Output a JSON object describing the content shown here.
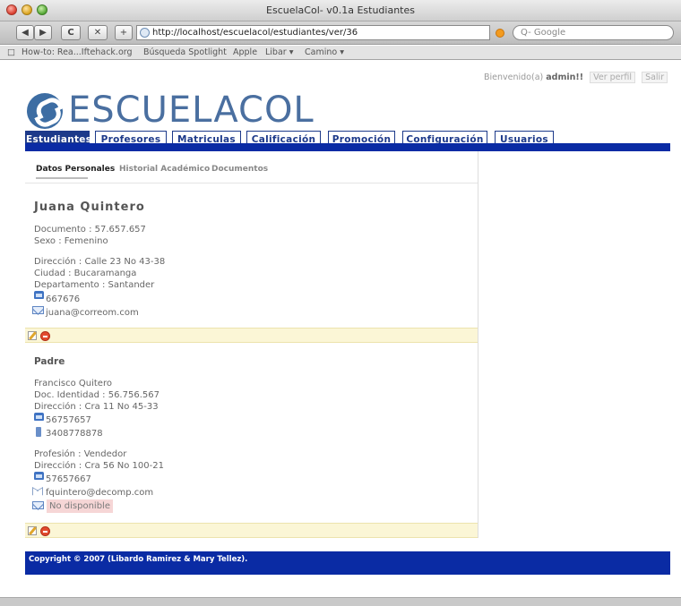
{
  "window": {
    "title": "EscuelaCol- v0.1a Estudiantes"
  },
  "toolbar": {
    "url": "http://localhost/escuelacol/estudiantes/ver/36",
    "search_placeholder": "Q- Google",
    "back_glyph": "◀",
    "forward_glyph": "▶",
    "reload_glyph": "C",
    "stop_glyph": "✕",
    "add_glyph": "+"
  },
  "bookmarks": {
    "items": [
      "How-to: Rea...Iftehack.org",
      "Búsqueda Spotlight",
      "Apple",
      "Libar ▾",
      "Camino ▾"
    ]
  },
  "header": {
    "welcome_prefix": "Bienvenido(a)",
    "user": "admin!!",
    "profile_link": "Ver perfil",
    "logout_link": "Salir",
    "logo_text": "ESCUELACOL"
  },
  "tabs": [
    "Estudiantes",
    "Profesores",
    "Matriculas",
    "Calificación",
    "Promoción",
    "Configuración",
    "Usuarios"
  ],
  "subtabs": [
    "Datos Personales",
    "Historial Académico",
    "Documentos"
  ],
  "student": {
    "name": "Juana Quintero",
    "document": "Documento : 57.657.657",
    "sex": "Sexo : Femenino",
    "address": "Dirección : Calle 23 No 43-38",
    "city": "Ciudad : Bucaramanga",
    "department": "Departamento : Santander",
    "phone": "667676",
    "email": "juana@correom.com"
  },
  "parent": {
    "heading": "Padre",
    "name": "Francisco Quitero",
    "id_doc": "Doc. Identidad : 56.756.567",
    "address": "Dirección : Cra 11 No 45-33",
    "phone": "56757657",
    "mobile": "3408778878",
    "profession": "Profesión : Vendedor",
    "work_address": "Dirección : Cra 56 No 100-21",
    "work_phone": "57657667",
    "email": "fquintero@decomp.com",
    "email2": "No disponible"
  },
  "footer": {
    "text": "Copyright © 2007 (Libardo Ramirez & Mary Tellez)."
  },
  "colors": {
    "nav_blue": "#0a2ba4",
    "tab_blue": "#1d3a8a",
    "action_bar": "#fbf6d6"
  },
  "icons": [
    "phone-icon",
    "email-icon",
    "mobile-icon",
    "edit-icon",
    "delete-icon"
  ]
}
